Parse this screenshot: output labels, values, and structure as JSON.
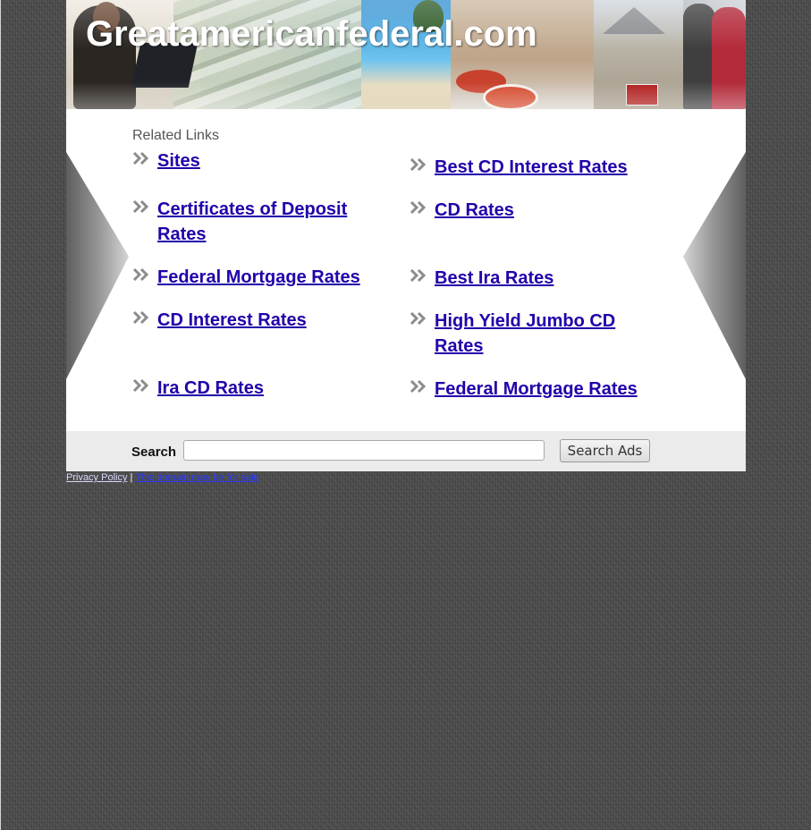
{
  "header": {
    "site_title": "Greatamericanfederal.com"
  },
  "content": {
    "related_heading": "Related Links",
    "links_left": [
      {
        "label": "Sites"
      },
      {
        "label": "Certificates of Deposit Rates"
      },
      {
        "label": "Federal Mortgage Rates"
      },
      {
        "label": "CD Interest Rates"
      },
      {
        "label": "Ira CD Rates"
      }
    ],
    "links_right": [
      {
        "label": "Best CD Interest Rates"
      },
      {
        "label": "CD Rates"
      },
      {
        "label": "Best Ira Rates"
      },
      {
        "label": "High Yield Jumbo CD Rates"
      },
      {
        "label": "Federal Mortgage Rates"
      }
    ]
  },
  "search": {
    "label": "Search",
    "input_value": "",
    "button_label": "Search Ads"
  },
  "footer": {
    "privacy_label": "Privacy Policy",
    "separator": "|",
    "sale_label": "This domain may be for sale"
  },
  "colors": {
    "link": "#2200aa",
    "heading": "#555555",
    "search_bar": "#ebebeb",
    "page_background": "#4a4a4a"
  },
  "icons": {
    "link_bullet": "double-chevron-right-icon"
  }
}
